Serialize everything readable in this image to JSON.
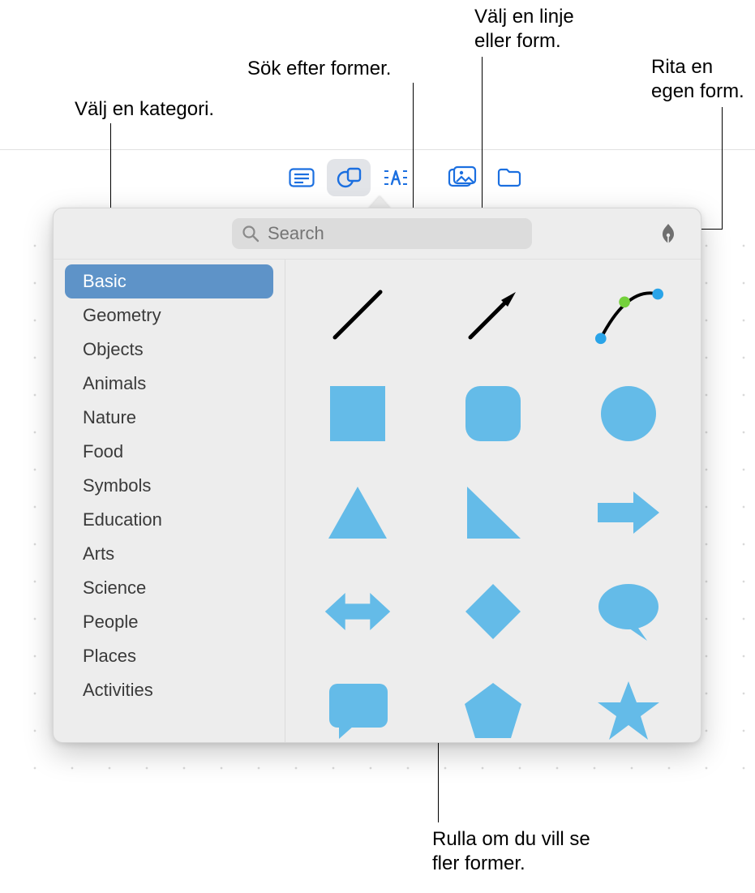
{
  "callouts": {
    "choose_category": "Välj en kategori.",
    "search_shapes": "Sök efter former.",
    "choose_line_shape": "Välj en linje\neller form.",
    "draw_custom": "Rita en\negen form.",
    "scroll_more": "Rulla om du vill se\nfler former."
  },
  "toolbar": {
    "buttons": [
      "text-box",
      "shapes",
      "text-style",
      "media",
      "files"
    ],
    "selected": "shapes"
  },
  "search": {
    "placeholder": "Search",
    "value": ""
  },
  "sidebar": {
    "items": [
      {
        "label": "Basic",
        "selected": true
      },
      {
        "label": "Geometry",
        "selected": false
      },
      {
        "label": "Objects",
        "selected": false
      },
      {
        "label": "Animals",
        "selected": false
      },
      {
        "label": "Nature",
        "selected": false
      },
      {
        "label": "Food",
        "selected": false
      },
      {
        "label": "Symbols",
        "selected": false
      },
      {
        "label": "Education",
        "selected": false
      },
      {
        "label": "Arts",
        "selected": false
      },
      {
        "label": "Science",
        "selected": false
      },
      {
        "label": "People",
        "selected": false
      },
      {
        "label": "Places",
        "selected": false
      },
      {
        "label": "Activities",
        "selected": false
      }
    ]
  },
  "shapes": [
    "line",
    "arrow-line",
    "curve-editable",
    "square",
    "rounded-square",
    "circle",
    "triangle",
    "right-triangle",
    "arrow-right",
    "arrow-leftright",
    "diamond",
    "speech-bubble",
    "callout-rect",
    "pentagon",
    "star"
  ],
  "colors": {
    "accent": "#1b6fe0",
    "shape_fill": "#64bbe8",
    "sidebar_selected": "#5e93c8"
  }
}
